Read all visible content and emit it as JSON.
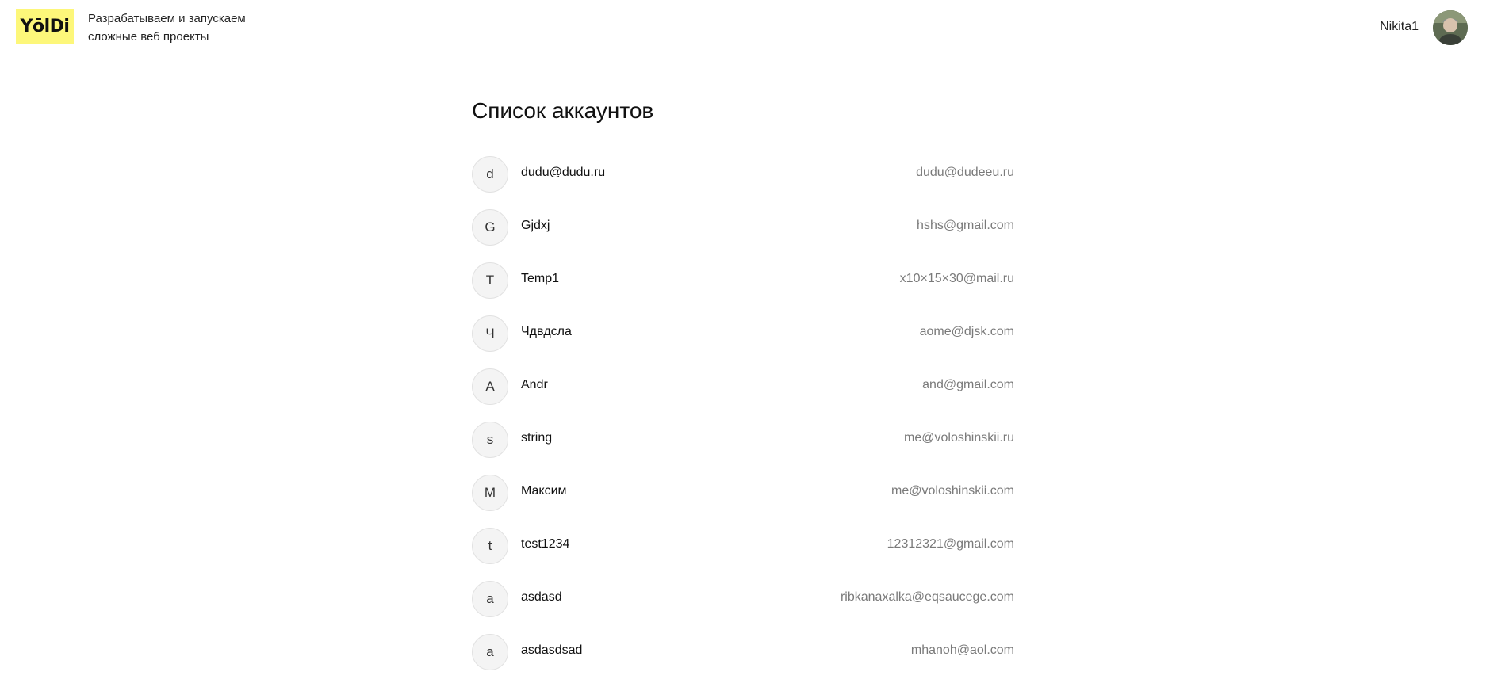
{
  "header": {
    "logo_text": "YōlDi",
    "tagline_line1": "Разрабатываем и запускаем",
    "tagline_line2": "сложные веб проекты",
    "user_name": "Nikita1",
    "brand_color": "#fdf77a"
  },
  "main": {
    "title": "Список аккаунтов",
    "accounts": [
      {
        "initial": "d",
        "name": "dudu@dudu.ru",
        "email": "dudu@dudeeu.ru"
      },
      {
        "initial": "G",
        "name": "Gjdxj",
        "email": "hshs@gmail.com"
      },
      {
        "initial": "T",
        "name": "Temp1",
        "email": "x10×15×30@mail.ru"
      },
      {
        "initial": "Ч",
        "name": "Чдвдсла",
        "email": "aome@djsk.com"
      },
      {
        "initial": "A",
        "name": "Andr",
        "email": "and@gmail.com"
      },
      {
        "initial": "s",
        "name": "string",
        "email": "me@voloshinskii.ru"
      },
      {
        "initial": "М",
        "name": "Максим",
        "email": "me@voloshinskii.com"
      },
      {
        "initial": "t",
        "name": "test1234",
        "email": "12312321@gmail.com"
      },
      {
        "initial": "a",
        "name": "asdasd",
        "email": "ribkanaxalka@eqsaucege.com"
      },
      {
        "initial": "a",
        "name": "asdasdsad",
        "email": "mhanoh@aol.com"
      }
    ]
  }
}
